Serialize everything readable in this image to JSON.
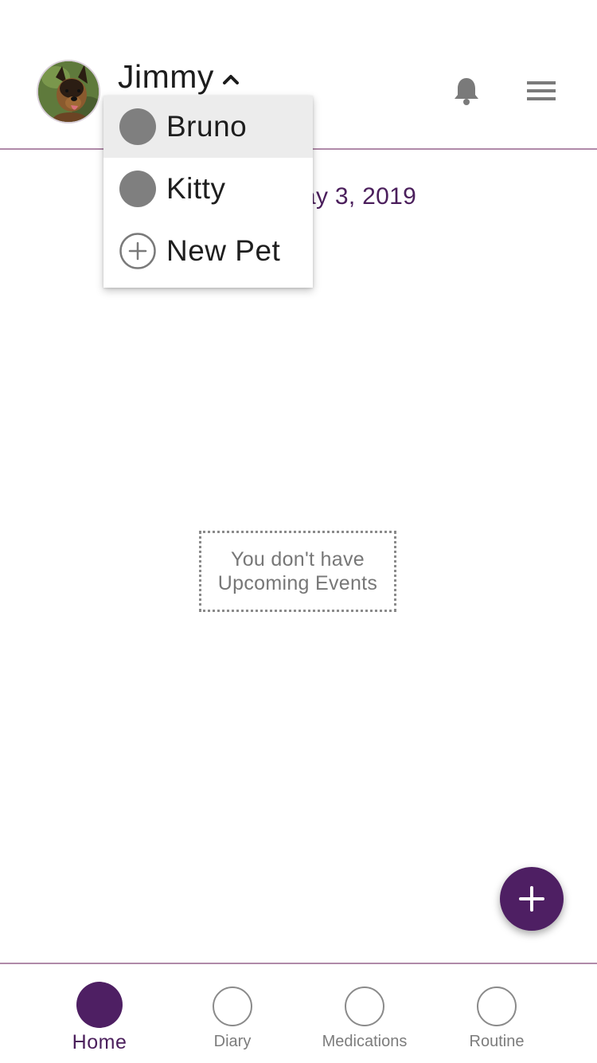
{
  "header": {
    "current_pet": "Jimmy",
    "avatar_icon": "dog-photo-avatar",
    "notifications_icon": "bell-icon",
    "menu_icon": "hamburger-menu-icon"
  },
  "pet_dropdown": {
    "items": [
      {
        "label": "Bruno",
        "icon": "pet-avatar-placeholder",
        "selected": true
      },
      {
        "label": "Kitty",
        "icon": "pet-avatar-placeholder",
        "selected": false
      },
      {
        "label": "New Pet",
        "icon": "add-circle-icon",
        "selected": false
      }
    ]
  },
  "date_text": "ay 3, 2019",
  "empty_state": {
    "line1": "You don't have",
    "line2": "Upcoming Events"
  },
  "fab_icon": "plus-icon",
  "bottom_nav": {
    "items": [
      {
        "label": "Home",
        "active": true
      },
      {
        "label": "Diary",
        "active": false
      },
      {
        "label": "Medications",
        "active": false
      },
      {
        "label": "Routine",
        "active": false
      }
    ]
  },
  "colors": {
    "accent": "#4e1f63",
    "divider": "#b08aa9",
    "muted_text": "#7c7c7c",
    "placeholder_grey": "#7f7f7f"
  }
}
